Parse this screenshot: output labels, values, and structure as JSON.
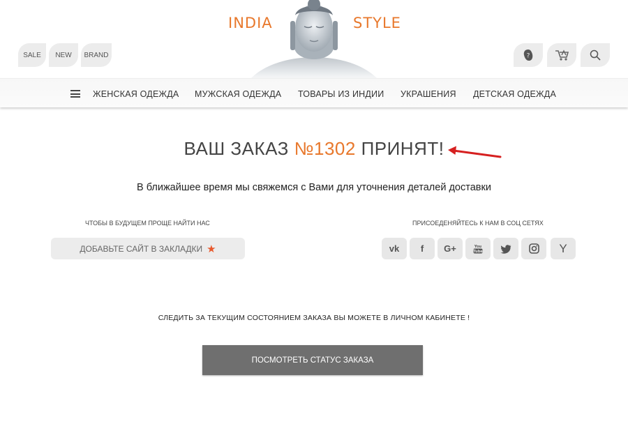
{
  "header": {
    "logo_left": "INDIA",
    "logo_right": "STYLE",
    "quick_links": [
      "SALE",
      "NEW",
      "BRAND"
    ],
    "icons": [
      "help-icon",
      "cart-icon",
      "search-icon"
    ]
  },
  "nav": {
    "menu_icon": "hamburger-icon",
    "items": [
      "ЖЕНСКАЯ ОДЕЖДА",
      "МУЖСКАЯ ОДЕЖДА",
      "ТОВАРЫ ИЗ ИНДИИ",
      "УКРАШЕНИЯ",
      "ДЕТСКАЯ ОДЕЖДА"
    ]
  },
  "order": {
    "prefix": "ВАШ ЗАКАЗ",
    "number": "№1302",
    "suffix": "ПРИНЯТ!",
    "subtitle": "В ближайшее время мы свяжемся с Вами для уточнения деталей доставки"
  },
  "bookmark": {
    "caption": "ЧТОБЫ В БУДУЩЕМ ПРОЩЕ НАЙТИ НАС",
    "button_label": "ДОБАВЬТЕ САЙТ В ЗАКЛАДКИ",
    "star_glyph": "★"
  },
  "social": {
    "caption": "ПРИСОЕДЕНЯЙТЕСЬ К НАМ В СОЦ СЕТЯХ",
    "buttons": [
      "vk-icon",
      "facebook-icon",
      "google-plus-icon",
      "youtube-icon",
      "twitter-icon",
      "instagram-icon",
      "yandex-icon"
    ],
    "glyphs": [
      "vk",
      "f",
      "G+",
      "▶",
      "🐦",
      "◎",
      "Y"
    ]
  },
  "tracking": {
    "text": "СЛЕДИТЬ ЗА ТЕКУЩИМ СОСТОЯНИЕМ ЗАКАЗА ВЫ МОЖЕТЕ В ЛИЧНОМ КАБИНЕТЕ !",
    "button_label": "ПОСМОТРЕТЬ СТАТУС ЗАКАЗА"
  },
  "colors": {
    "accent": "#e8782c",
    "button_dark": "#6f6f6f",
    "arrow": "#d62020"
  }
}
